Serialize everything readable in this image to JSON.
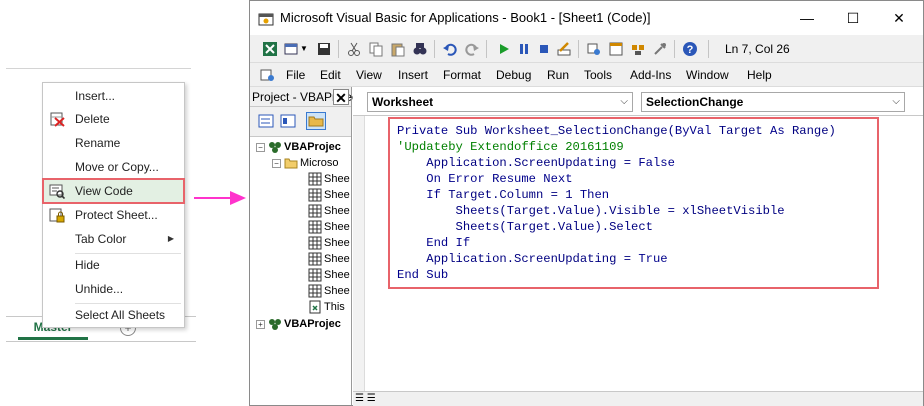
{
  "excel": {
    "sheet_tab": "Master",
    "add_sheet_symbol": "+"
  },
  "context_menu": {
    "items": [
      {
        "label": "Insert...",
        "icon": ""
      },
      {
        "label": "Delete",
        "icon": "delete-sheet-icon"
      },
      {
        "label": "Rename",
        "icon": ""
      },
      {
        "label": "Move or Copy...",
        "icon": ""
      },
      {
        "label": "View Code",
        "icon": "view-code-icon",
        "highlighted": true
      },
      {
        "label": "Protect Sheet...",
        "icon": "protect-sheet-icon"
      },
      {
        "label": "Tab Color",
        "icon": "",
        "submenu": true
      },
      {
        "label": "Hide",
        "icon": ""
      },
      {
        "label": "Unhide...",
        "icon": ""
      },
      {
        "label": "Select All Sheets",
        "icon": ""
      }
    ],
    "highlight_color": "#e8636a",
    "arrow_color": "#ff33cc"
  },
  "vba": {
    "title": "Microsoft Visual Basic for Applications - Book1 - [Sheet1 (Code)]",
    "window_controls": {
      "minimize": "—",
      "maximize": "☐",
      "close": "✕"
    },
    "status": "Ln 7, Col 26",
    "menus": [
      "File",
      "Edit",
      "View",
      "Insert",
      "Format",
      "Debug",
      "Run",
      "Tools",
      "Add-Ins",
      "Window",
      "Help"
    ],
    "project_panel": {
      "title": "Project - VBAProject",
      "close": "✕",
      "tree": [
        {
          "label": "VBAProjec",
          "bold": true,
          "icon": "vba-project-icon"
        },
        {
          "label": "Microso",
          "bold": false,
          "icon": "folder-icon"
        },
        {
          "label": "Shee",
          "icon": "sheet-icon"
        },
        {
          "label": "Shee",
          "icon": "sheet-icon"
        },
        {
          "label": "Shee",
          "icon": "sheet-icon"
        },
        {
          "label": "Shee",
          "icon": "sheet-icon"
        },
        {
          "label": "Shee",
          "icon": "sheet-icon"
        },
        {
          "label": "Shee",
          "icon": "sheet-icon"
        },
        {
          "label": "Shee",
          "icon": "sheet-icon"
        },
        {
          "label": "Shee",
          "icon": "sheet-icon"
        },
        {
          "label": "This",
          "icon": "workbook-icon"
        },
        {
          "label": "VBAProjec",
          "bold": true,
          "icon": "vba-project-icon"
        }
      ]
    },
    "object_combo": "Worksheet",
    "procedure_combo": "SelectionChange",
    "code_lines": [
      "Private Sub Worksheet_SelectionChange(ByVal Target As Range)",
      "'Updateby Extendoffice 20161109",
      "    Application.ScreenUpdating = False",
      "    On Error Resume Next",
      "    If Target.Column = 1 Then",
      "        Sheets(Target.Value).Visible = xlSheetVisible",
      "        Sheets(Target.Value).Select",
      "    End If",
      "    Application.ScreenUpdating = True",
      "End Sub"
    ]
  }
}
